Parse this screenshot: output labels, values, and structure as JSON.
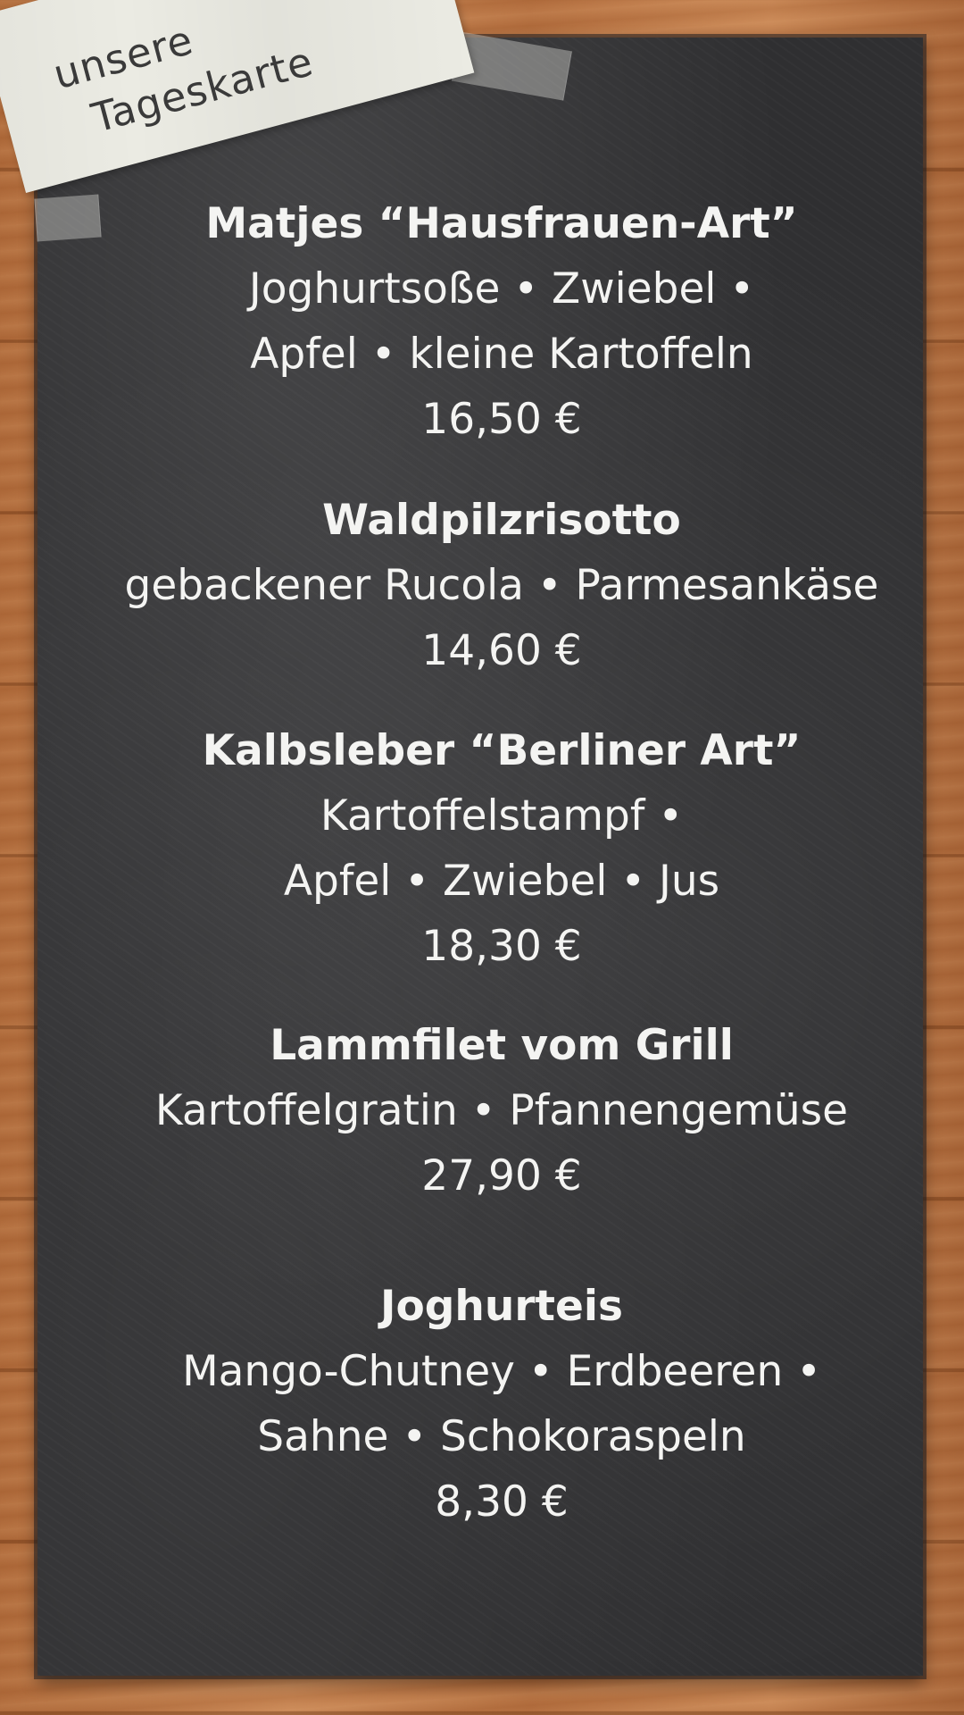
{
  "note": {
    "line1": "unsere",
    "line2": "Tageskarte"
  },
  "menu": {
    "items": [
      {
        "name": "Matjes “Hausfrauen-Art”",
        "desc": [
          "Joghurtsoße • Zwiebel •",
          "Apfel • kleine Kartoffeln"
        ],
        "price": "16,50 €"
      },
      {
        "name": "Waldpilzrisotto",
        "desc": [
          "gebackener  Rucola • Parmesankäse"
        ],
        "price": "14,60 €"
      },
      {
        "name": "Kalbsleber “Berliner Art”",
        "desc": [
          "Kartoffelstampf •",
          "Apfel • Zwiebel • Jus"
        ],
        "price": "18,30 €"
      },
      {
        "name": "Lammfilet vom Grill",
        "desc": [
          "Kartoffelgratin • Pfannengemüse"
        ],
        "price": "27,90 €"
      },
      {
        "name": "Joghurteis",
        "desc": [
          "Mango-Chutney • Erdbeeren •",
          "Sahne • Schokoraspeln"
        ],
        "price": "8,30 €"
      }
    ]
  }
}
